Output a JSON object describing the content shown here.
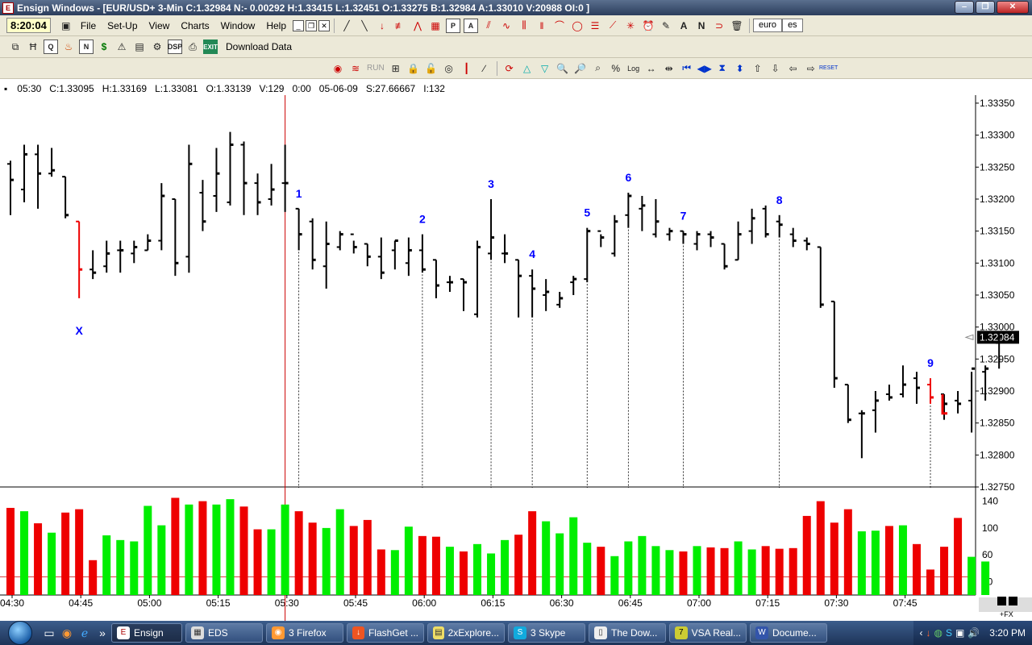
{
  "window": {
    "title": "Ensign Windows - [EUR/USD+ 3-Min C:1.32984 N:- 0.00292 H:1.33415 L:1.32451 O:1.33275 B:1.32984 A:1.33010 V:20988 OI:0 ]",
    "app_icon_label": "E"
  },
  "menubar": {
    "clock": "8:20:04",
    "items": [
      "File",
      "Set-Up",
      "View",
      "Charts",
      "Window",
      "Help"
    ],
    "symbol_tabs": [
      "euro",
      "es"
    ]
  },
  "toolbar2": {
    "download_label": "Download Data"
  },
  "toolbar3": {
    "run_label": "RUN"
  },
  "infobar": {
    "time": "05:30",
    "close": "C:1.33095",
    "high": "H:1.33169",
    "low": "L:1.33081",
    "open": "O:1.33139",
    "volume": "V:129",
    "tick": "0:00",
    "date": "05-06-09",
    "study": "S:27.66667",
    "interval": "I:132"
  },
  "colors": {
    "up": "#00ee00",
    "down": "#ee0000",
    "label": "#0000ff",
    "cursor": "#cc0000"
  },
  "chart_data": {
    "type": "bar",
    "price_axis": [
      "1.33350",
      "1.33300",
      "1.33250",
      "1.33200",
      "1.33150",
      "1.33100",
      "1.33050",
      "1.33000",
      "1.32950",
      "1.32900",
      "1.32850",
      "1.32800",
      "1.32750"
    ],
    "price_range": [
      1.3275,
      1.3336
    ],
    "last_price": "1.32984",
    "volume_axis": [
      "140",
      "100",
      "60",
      "20"
    ],
    "volume_range": [
      0,
      160
    ],
    "time_axis": [
      "04:30",
      "04:45",
      "05:00",
      "05:15",
      "05:30",
      "05:45",
      "06:00",
      "06:15",
      "06:30",
      "06:45",
      "07:00",
      "07:15",
      "07:30",
      "07:45"
    ],
    "price_bars": [
      {
        "o": 1.33255,
        "h": 1.3326,
        "l": 1.33175,
        "c": 1.3323
      },
      {
        "o": 1.33215,
        "h": 1.33285,
        "l": 1.33195,
        "c": 1.3327
      },
      {
        "o": 1.3327,
        "h": 1.33285,
        "l": 1.33185,
        "c": 1.3324
      },
      {
        "o": 1.3324,
        "h": 1.3328,
        "l": 1.33235,
        "c": 1.33245
      },
      {
        "o": 1.33235,
        "h": 1.33235,
        "l": 1.3317,
        "c": 1.33175
      },
      {
        "o": 1.33165,
        "h": 1.33165,
        "l": 1.33045,
        "c": 1.3309
      },
      {
        "o": 1.3309,
        "h": 1.3312,
        "l": 1.33075,
        "c": 1.33085
      },
      {
        "o": 1.33095,
        "h": 1.33135,
        "l": 1.33085,
        "c": 1.33115
      },
      {
        "o": 1.3312,
        "h": 1.33135,
        "l": 1.33085,
        "c": 1.3312
      },
      {
        "o": 1.33115,
        "h": 1.33135,
        "l": 1.331,
        "c": 1.33125
      },
      {
        "o": 1.3312,
        "h": 1.33145,
        "l": 1.3312,
        "c": 1.33135
      },
      {
        "o": 1.33135,
        "h": 1.33225,
        "l": 1.3312,
        "c": 1.33205
      },
      {
        "o": 1.332,
        "h": 1.332,
        "l": 1.3308,
        "c": 1.331
      },
      {
        "o": 1.3311,
        "h": 1.33285,
        "l": 1.33085,
        "c": 1.33255
      },
      {
        "o": 1.3321,
        "h": 1.3323,
        "l": 1.3315,
        "c": 1.33165
      },
      {
        "o": 1.33205,
        "h": 1.3328,
        "l": 1.3318,
        "c": 1.3324
      },
      {
        "o": 1.33195,
        "h": 1.33305,
        "l": 1.3319,
        "c": 1.33285
      },
      {
        "o": 1.33285,
        "h": 1.3329,
        "l": 1.33175,
        "c": 1.33225
      },
      {
        "o": 1.33225,
        "h": 1.3324,
        "l": 1.33175,
        "c": 1.33195
      },
      {
        "o": 1.332,
        "h": 1.33255,
        "l": 1.3319,
        "c": 1.33215
      },
      {
        "o": 1.33225,
        "h": 1.33285,
        "l": 1.3318,
        "c": 1.33225
      },
      {
        "o": 1.33185,
        "h": 1.33185,
        "l": 1.3312,
        "c": 1.33145
      },
      {
        "o": 1.33165,
        "h": 1.3317,
        "l": 1.3309,
        "c": 1.33105
      },
      {
        "o": 1.33095,
        "h": 1.33165,
        "l": 1.3306,
        "c": 1.3313
      },
      {
        "o": 1.33125,
        "h": 1.3315,
        "l": 1.3312,
        "c": 1.33145
      },
      {
        "o": 1.33145,
        "h": 1.33135,
        "l": 1.33115,
        "c": 1.33125
      },
      {
        "o": 1.3313,
        "h": 1.3313,
        "l": 1.33095,
        "c": 1.3311
      },
      {
        "o": 1.3311,
        "h": 1.3314,
        "l": 1.33075,
        "c": 1.33085
      },
      {
        "o": 1.3312,
        "h": 1.33135,
        "l": 1.3309,
        "c": 1.33135
      },
      {
        "o": 1.331,
        "h": 1.3314,
        "l": 1.3308,
        "c": 1.3312
      },
      {
        "o": 1.3312,
        "h": 1.33145,
        "l": 1.33085,
        "c": 1.3309
      },
      {
        "o": 1.33105,
        "h": 1.33105,
        "l": 1.33045,
        "c": 1.33065
      },
      {
        "o": 1.3307,
        "h": 1.3308,
        "l": 1.33055,
        "c": 1.3307
      },
      {
        "o": 1.33075,
        "h": 1.33075,
        "l": 1.33025,
        "c": 1.3307
      },
      {
        "o": 1.3302,
        "h": 1.33135,
        "l": 1.33015,
        "c": 1.33125
      },
      {
        "o": 1.33115,
        "h": 1.332,
        "l": 1.33105,
        "c": 1.3314
      },
      {
        "o": 1.33115,
        "h": 1.33145,
        "l": 1.331,
        "c": 1.33115
      },
      {
        "o": 1.33105,
        "h": 1.33105,
        "l": 1.33015,
        "c": 1.3308
      },
      {
        "o": 1.3308,
        "h": 1.3309,
        "l": 1.33015,
        "c": 1.3306
      },
      {
        "o": 1.3305,
        "h": 1.33075,
        "l": 1.33025,
        "c": 1.33055
      },
      {
        "o": 1.33035,
        "h": 1.33055,
        "l": 1.3303,
        "c": 1.33045
      },
      {
        "o": 1.3307,
        "h": 1.3308,
        "l": 1.3305,
        "c": 1.33075
      },
      {
        "o": 1.33075,
        "h": 1.33155,
        "l": 1.3307,
        "c": 1.3315
      },
      {
        "o": 1.3315,
        "h": 1.33145,
        "l": 1.33125,
        "c": 1.3314
      },
      {
        "o": 1.33115,
        "h": 1.33175,
        "l": 1.3311,
        "c": 1.33165
      },
      {
        "o": 1.33175,
        "h": 1.3321,
        "l": 1.33155,
        "c": 1.33205
      },
      {
        "o": 1.33185,
        "h": 1.33205,
        "l": 1.3315,
        "c": 1.3319
      },
      {
        "o": 1.33145,
        "h": 1.332,
        "l": 1.3314,
        "c": 1.33165
      },
      {
        "o": 1.33145,
        "h": 1.33155,
        "l": 1.33135,
        "c": 1.3315
      },
      {
        "o": 1.3315,
        "h": 1.3315,
        "l": 1.3313,
        "c": 1.33145
      },
      {
        "o": 1.3313,
        "h": 1.3315,
        "l": 1.3312,
        "c": 1.33145
      },
      {
        "o": 1.33145,
        "h": 1.3315,
        "l": 1.33125,
        "c": 1.3314
      },
      {
        "o": 1.3313,
        "h": 1.3313,
        "l": 1.3309,
        "c": 1.33095
      },
      {
        "o": 1.33105,
        "h": 1.33165,
        "l": 1.33105,
        "c": 1.33145
      },
      {
        "o": 1.3315,
        "h": 1.33185,
        "l": 1.3313,
        "c": 1.3317
      },
      {
        "o": 1.33185,
        "h": 1.3319,
        "l": 1.3314,
        "c": 1.33145
      },
      {
        "o": 1.33165,
        "h": 1.33175,
        "l": 1.3314,
        "c": 1.3316
      },
      {
        "o": 1.33145,
        "h": 1.33155,
        "l": 1.33125,
        "c": 1.33135
      },
      {
        "o": 1.33135,
        "h": 1.3314,
        "l": 1.3312,
        "c": 1.3313
      },
      {
        "o": 1.33125,
        "h": 1.33125,
        "l": 1.3303,
        "c": 1.33035
      },
      {
        "o": 1.3304,
        "h": 1.3304,
        "l": 1.32905,
        "c": 1.3292
      },
      {
        "o": 1.3291,
        "h": 1.3291,
        "l": 1.3285,
        "c": 1.32855
      },
      {
        "o": 1.32865,
        "h": 1.3287,
        "l": 1.32795,
        "c": 1.32865
      },
      {
        "o": 1.3287,
        "h": 1.329,
        "l": 1.32835,
        "c": 1.32885
      },
      {
        "o": 1.32895,
        "h": 1.3291,
        "l": 1.32885,
        "c": 1.3289
      },
      {
        "o": 1.32895,
        "h": 1.3294,
        "l": 1.3289,
        "c": 1.3291
      },
      {
        "o": 1.3292,
        "h": 1.3293,
        "l": 1.3288,
        "c": 1.32905
      },
      {
        "o": 1.3291,
        "h": 1.3292,
        "l": 1.3288,
        "c": 1.3289
      },
      {
        "o": 1.32895,
        "h": 1.32895,
        "l": 1.32855,
        "c": 1.3288
      },
      {
        "o": 1.32885,
        "h": 1.329,
        "l": 1.32865,
        "c": 1.3288
      },
      {
        "o": 1.32885,
        "h": 1.3293,
        "l": 1.32835,
        "c": 1.32935
      },
      {
        "o": 1.3293,
        "h": 1.3294,
        "l": 1.32885,
        "c": 1.32935
      },
      {
        "o": 1.32975,
        "h": 1.3299,
        "l": 1.32935,
        "c": 1.32985
      }
    ],
    "volumes": [
      130,
      125,
      107,
      93,
      123,
      128,
      52,
      89,
      82,
      80,
      133,
      104,
      145,
      135,
      140,
      135,
      143,
      132,
      98,
      98,
      135,
      125,
      108,
      100,
      128,
      103,
      112,
      68,
      67,
      102,
      88,
      87,
      72,
      65,
      76,
      62,
      82,
      90,
      125,
      110,
      92,
      116,
      78,
      72,
      58,
      80,
      88,
      73,
      67,
      65,
      73,
      71,
      70,
      80,
      68,
      73,
      69,
      70,
      118,
      140,
      108,
      128,
      95,
      96,
      103,
      104,
      76,
      38,
      72,
      115,
      57,
      50
    ],
    "red_marker_bars": [
      5,
      67
    ],
    "cursor_time": "05:30",
    "annotations": [
      "X",
      "1",
      "2",
      "3",
      "4",
      "5",
      "6",
      "7",
      "8",
      "9"
    ]
  },
  "taskbar": {
    "tasks": [
      "Ensign",
      "EDS",
      "3 Firefox",
      "FlashGet ...",
      "2xExplore...",
      "3 Skype",
      "The Dow...",
      "VSA Real...",
      "Docume..."
    ],
    "clock": "3:20 PM"
  },
  "status": {
    "fx_label": "+FX"
  }
}
